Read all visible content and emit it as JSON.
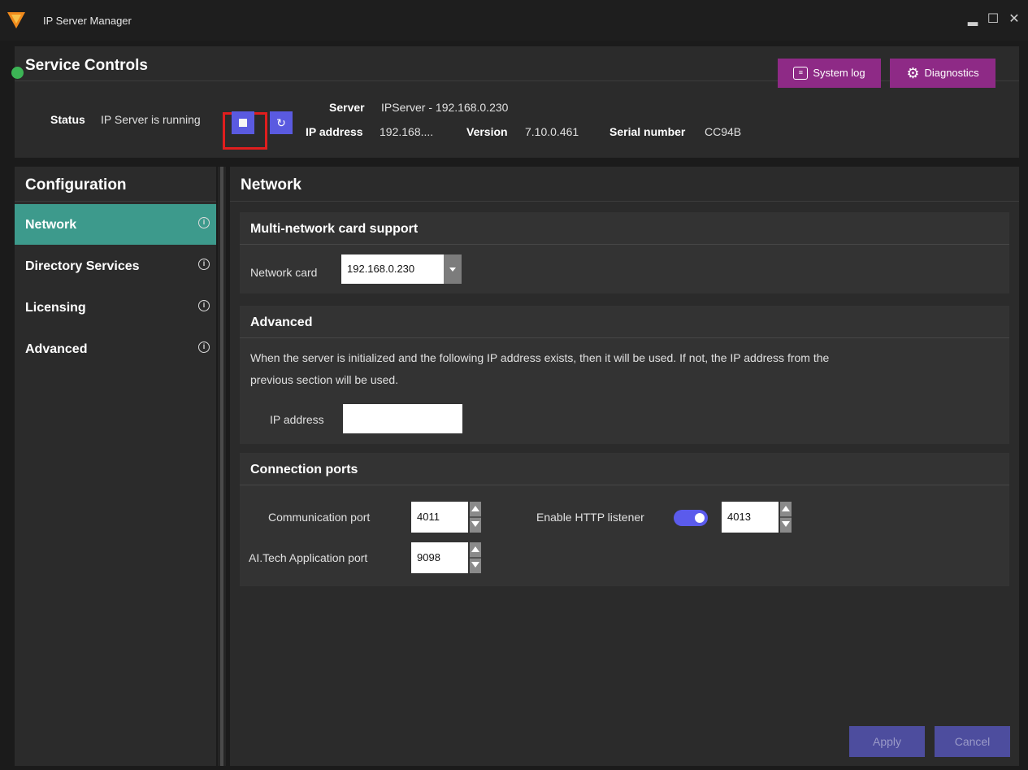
{
  "window": {
    "title": "IP Server Manager"
  },
  "service_controls": {
    "heading": "Service Controls",
    "status_label": "Status",
    "status_value": "IP Server is running",
    "server_label": "Server",
    "server_value": "IPServer - 192.168.0.230",
    "ip_label": "IP address",
    "ip_value": "192.168....",
    "version_label": "Version",
    "version_value": "7.10.0.461",
    "serial_label": "Serial number",
    "serial_value": "CC94B",
    "system_log_label": "System log",
    "diagnostics_label": "Diagnostics",
    "status_color": "#3cb455"
  },
  "configuration": {
    "heading": "Configuration",
    "items": [
      {
        "label": "Network",
        "active": true
      },
      {
        "label": "Directory Services",
        "active": false
      },
      {
        "label": "Licensing",
        "active": false
      },
      {
        "label": "Advanced",
        "active": false
      }
    ]
  },
  "network": {
    "heading": "Network",
    "multi_card": {
      "heading": "Multi-network card support",
      "card_label": "Network card",
      "card_value": "192.168.0.230"
    },
    "advanced": {
      "heading": "Advanced",
      "description_line1": "When the server is initialized and the following IP address exists, then it will be used. If not, the IP address from the",
      "description_line2": "previous section will be used.",
      "ip_label": "IP address",
      "ip_value": ""
    },
    "ports": {
      "heading": "Connection ports",
      "comm_label": "Communication port",
      "comm_value": "4011",
      "http_label": "Enable HTTP listener",
      "http_enabled": true,
      "http_value": "4013",
      "aitech_label": "AI.Tech Application port",
      "aitech_value": "9098"
    },
    "apply_label": "Apply",
    "cancel_label": "Cancel"
  },
  "colors": {
    "accent_teal": "#3d9a8c",
    "accent_purple": "#8e2a86",
    "button_blue": "#5a5ae0"
  }
}
